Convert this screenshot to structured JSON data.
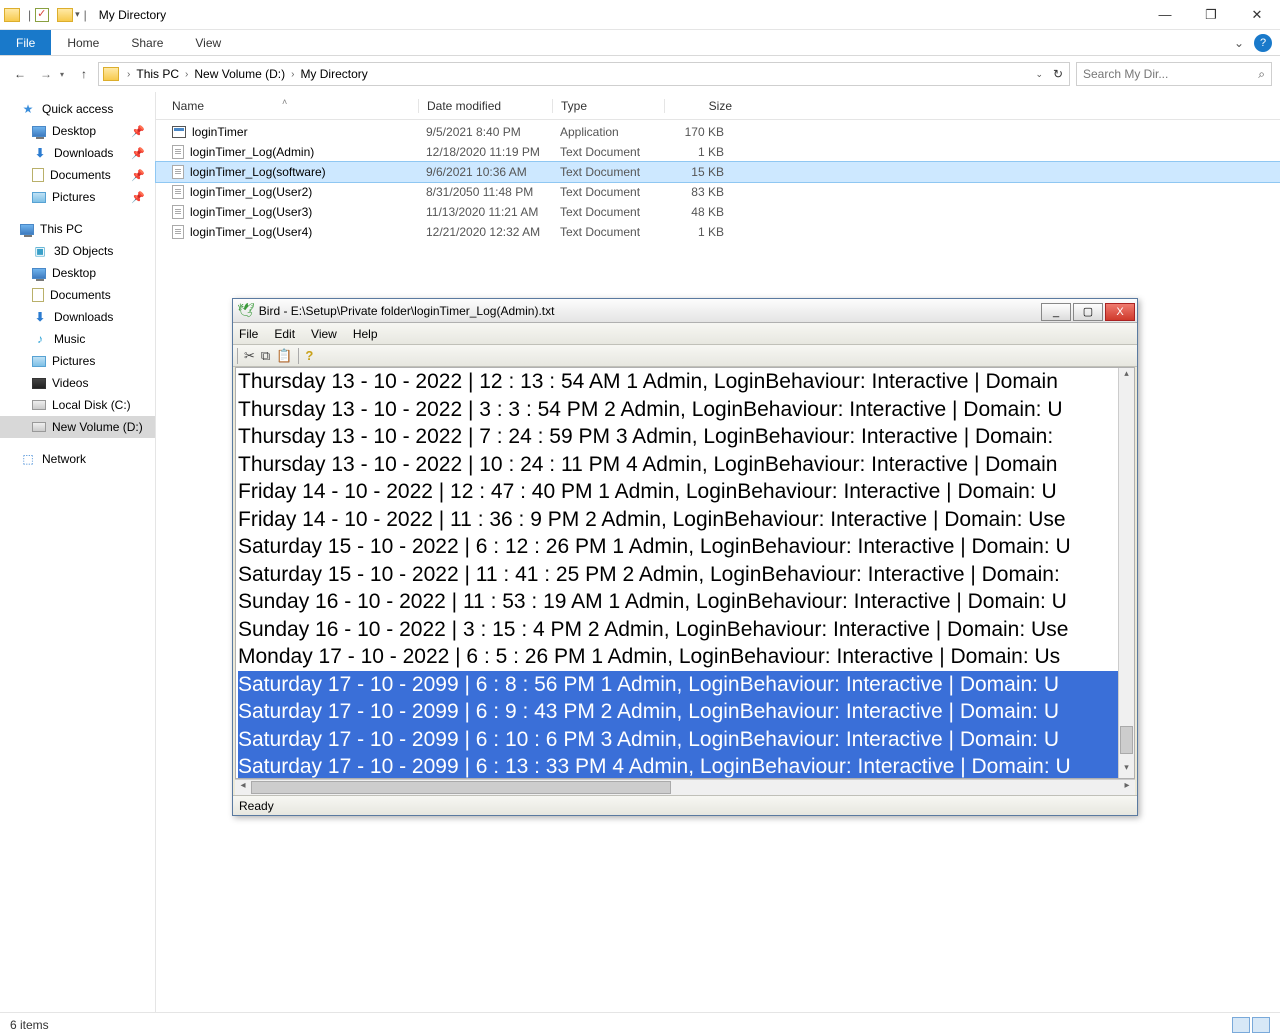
{
  "window": {
    "title": "My Directory"
  },
  "ribbon": {
    "file": "File",
    "home": "Home",
    "share": "Share",
    "view": "View"
  },
  "breadcrumb": {
    "items": [
      "This PC",
      "New Volume (D:)",
      "My Directory"
    ]
  },
  "search": {
    "placeholder": "Search My Dir..."
  },
  "sidebar": {
    "quick_access": "Quick access",
    "desktop": "Desktop",
    "downloads": "Downloads",
    "documents": "Documents",
    "pictures": "Pictures",
    "this_pc": "This PC",
    "objects3d": "3D Objects",
    "desktop2": "Desktop",
    "documents2": "Documents",
    "downloads2": "Downloads",
    "music": "Music",
    "pictures2": "Pictures",
    "videos": "Videos",
    "local_disk": "Local Disk (C:)",
    "new_volume": "New Volume (D:)",
    "network": "Network"
  },
  "columns": {
    "name": "Name",
    "date": "Date modified",
    "type": "Type",
    "size": "Size"
  },
  "files": [
    {
      "name": "loginTimer",
      "date": "9/5/2021 8:40 PM",
      "type": "Application",
      "size": "170 KB",
      "icon": "app"
    },
    {
      "name": "loginTimer_Log(Admin)",
      "date": "12/18/2020 11:19 PM",
      "type": "Text Document",
      "size": "1 KB",
      "icon": "txt"
    },
    {
      "name": "loginTimer_Log(software)",
      "date": "9/6/2021 10:36 AM",
      "type": "Text Document",
      "size": "15 KB",
      "icon": "txt",
      "selected": true
    },
    {
      "name": "loginTimer_Log(User2)",
      "date": "8/31/2050 11:48 PM",
      "type": "Text Document",
      "size": "83 KB",
      "icon": "txt"
    },
    {
      "name": "loginTimer_Log(User3)",
      "date": "11/13/2020 11:21 AM",
      "type": "Text Document",
      "size": "48 KB",
      "icon": "txt"
    },
    {
      "name": "loginTimer_Log(User4)",
      "date": "12/21/2020 12:32 AM",
      "type": "Text Document",
      "size": "1 KB",
      "icon": "txt"
    }
  ],
  "status": {
    "item_count": "6 items"
  },
  "editor": {
    "title": "Bird - E:\\Setup\\Private folder\\loginTimer_Log(Admin).txt",
    "menu": {
      "file": "File",
      "edit": "Edit",
      "view": "View",
      "help": "Help"
    },
    "status": "Ready",
    "lines": [
      {
        "text": "Thursday 13 - 10 - 2022 | 12 : 13 : 54 AM 1  Admin, LoginBehaviour: Interactive | Domain",
        "sel": false
      },
      {
        "text": "Thursday 13 - 10 - 2022 | 3 : 3 : 54 PM 2  Admin, LoginBehaviour: Interactive | Domain: U",
        "sel": false
      },
      {
        "text": "Thursday 13 - 10 - 2022 | 7 : 24 : 59 PM 3  Admin, LoginBehaviour: Interactive | Domain: ",
        "sel": false
      },
      {
        "text": "Thursday 13 - 10 - 2022 | 10 : 24 : 11 PM 4  Admin, LoginBehaviour: Interactive | Domain",
        "sel": false
      },
      {
        "text": "Friday 14 - 10 - 2022 | 12 : 47 : 40 PM 1  Admin, LoginBehaviour: Interactive | Domain: U",
        "sel": false
      },
      {
        "text": "Friday 14 - 10 - 2022 | 11 : 36 : 9 PM 2  Admin, LoginBehaviour: Interactive | Domain: Use",
        "sel": false
      },
      {
        "text": "Saturday 15 - 10 - 2022 | 6 : 12 : 26 PM 1  Admin, LoginBehaviour: Interactive | Domain: U",
        "sel": false
      },
      {
        "text": "Saturday 15 - 10 - 2022 | 11 : 41 : 25 PM 2  Admin, LoginBehaviour: Interactive | Domain:",
        "sel": false
      },
      {
        "text": "Sunday 16 - 10 - 2022 | 11 : 53 : 19 AM 1  Admin, LoginBehaviour: Interactive | Domain: U",
        "sel": false
      },
      {
        "text": "Sunday 16 - 10 - 2022 | 3 : 15 : 4 PM 2  Admin, LoginBehaviour: Interactive | Domain: Use",
        "sel": false
      },
      {
        "text": "Monday 17 - 10 - 2022 | 6 : 5 : 26 PM 1  Admin, LoginBehaviour: Interactive | Domain: Us",
        "sel": false
      },
      {
        "text": "Saturday 17 - 10 - 2099 | 6 : 8 : 56 PM 1  Admin, LoginBehaviour: Interactive | Domain: U",
        "sel": true
      },
      {
        "text": "Saturday 17 - 10 - 2099 | 6 : 9 : 43 PM 2  Admin, LoginBehaviour: Interactive | Domain: U",
        "sel": true
      },
      {
        "text": "Saturday 17 - 10 - 2099 | 6 : 10 : 6 PM 3  Admin, LoginBehaviour: Interactive | Domain: U",
        "sel": true
      },
      {
        "text": "Saturday 17 - 10 - 2099 | 6 : 13 : 33 PM 4  Admin, LoginBehaviour: Interactive | Domain: U",
        "sel": true
      }
    ]
  }
}
